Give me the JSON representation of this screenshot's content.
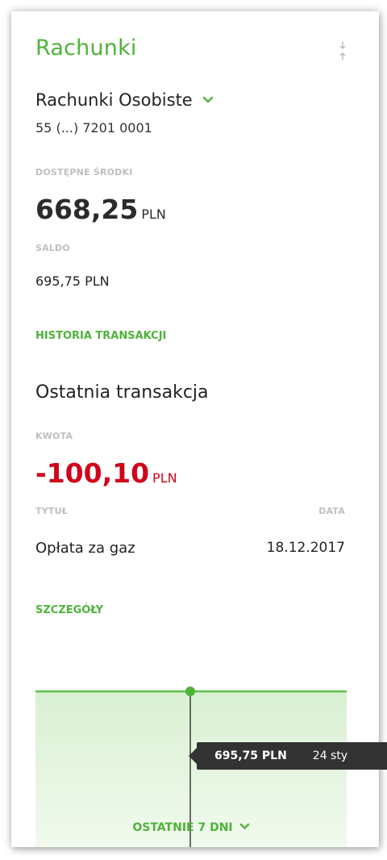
{
  "widget": {
    "title": "Rachunki"
  },
  "account": {
    "name": "Rachunki Osobiste",
    "number": "55 (...) 7201 0001"
  },
  "available": {
    "label": "DOSTĘPNE ŚRODKI",
    "value": "668,25",
    "currency": "PLN"
  },
  "balance": {
    "label": "SALDO",
    "value": "695,75 PLN"
  },
  "links": {
    "history": "HISTORIA TRANSAKCJI",
    "details": "SZCZEGÓŁY"
  },
  "last_transaction": {
    "heading": "Ostatnia transakcja",
    "amount_label": "KWOTA",
    "amount": "-100,10",
    "currency": "PLN",
    "title_label": "TYTUŁ",
    "date_label": "DATA",
    "title": "Opłata za gaz",
    "date": "18.12.2017"
  },
  "chart": {
    "period_label": "OSTATNIE 7 DNI",
    "tooltip_value": "695,75 PLN",
    "tooltip_date": "24 sty",
    "line_color": "#5cbf4c",
    "fill_color": "#dff2d9"
  },
  "colors": {
    "accent": "#4fb33a",
    "negative": "#d0021b"
  },
  "icons": {
    "drag": "drag-handle-icon",
    "chevron": "chevron-down-icon"
  }
}
